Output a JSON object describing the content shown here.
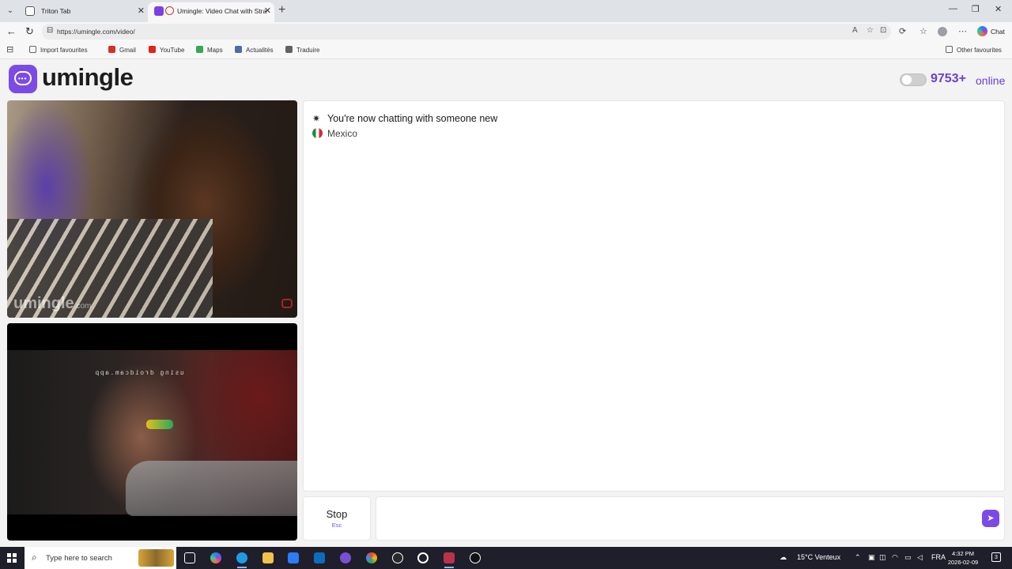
{
  "browser": {
    "tabs": [
      {
        "title": "Triton Tab"
      },
      {
        "title": "Umingle: Video Chat with Stra"
      }
    ],
    "url": "https://umingle.com/video/",
    "chat_label": "Chat",
    "bookmarks": [
      {
        "label": "Import favourites",
        "color": "#6b6b6b"
      },
      {
        "label": "Gmail",
        "color": "#d93025"
      },
      {
        "label": "YouTube",
        "color": "#e62117"
      },
      {
        "label": "Maps",
        "color": "#34a853"
      },
      {
        "label": "Actualités",
        "color": "#4a6fa5"
      },
      {
        "label": "Traduire",
        "color": "#5f6368"
      }
    ],
    "other_favourites": "Other favourites"
  },
  "site": {
    "logo_text": "umingle",
    "brand_color": "#7c4be6",
    "online_count": "9753+",
    "online_label": "online"
  },
  "video": {
    "remote_watermark": "umingle",
    "remote_watermark_suffix": ".com",
    "local_caption": "using droidcam.app"
  },
  "chat": {
    "status_message": "You're now chatting with someone new",
    "country": "Mexico",
    "stop_label": "Stop",
    "stop_shortcut": "Esc",
    "message_placeholder": ""
  },
  "taskbar": {
    "search_placeholder": "Type here to search",
    "weather": "15°C Venteux",
    "language": "FRA",
    "time": "4:32 PM",
    "date": "2026-02-09",
    "notification_count": "3"
  }
}
